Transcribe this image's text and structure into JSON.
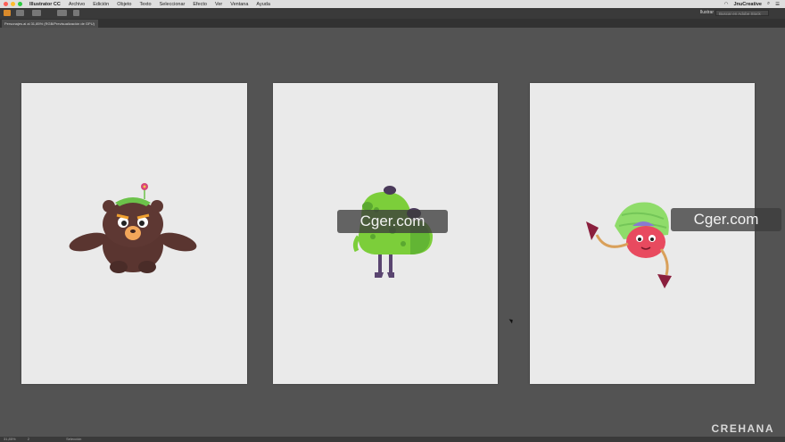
{
  "menubar": {
    "app_name": "Illustrator CC",
    "items": [
      "Archivo",
      "Edición",
      "Objeto",
      "Texto",
      "Seleccionar",
      "Efecto",
      "Ver",
      "Ventana",
      "Ayuda"
    ],
    "user": "JnuCreative"
  },
  "toolbar": {
    "workspace": "Ilustrar",
    "search_placeholder": "Buscar en Adobe Stock"
  },
  "document_tab": {
    "title": "Personajes.ai al 31,85% (RGB/Previsualización de GPU)"
  },
  "status": {
    "zoom": "31,85%",
    "artboard": "2",
    "tool": "Selección"
  },
  "watermark": "Cger.com",
  "brand": "CREHANA",
  "colors": {
    "canvas": "#535353",
    "artboard": "#eaeaea"
  }
}
